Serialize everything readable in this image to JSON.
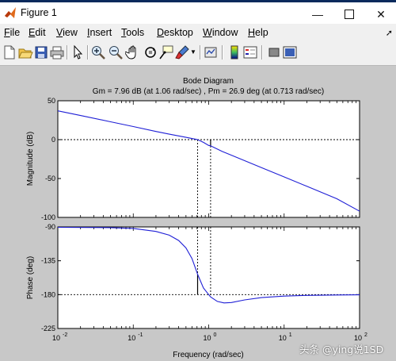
{
  "window": {
    "title": "Figure 1"
  },
  "menus": [
    {
      "key": "F",
      "rest": "ile"
    },
    {
      "key": "E",
      "rest": "dit"
    },
    {
      "key": "V",
      "rest": "iew"
    },
    {
      "key": "I",
      "rest": "nsert"
    },
    {
      "key": "T",
      "rest": "ools"
    },
    {
      "key": "D",
      "rest": "esktop"
    },
    {
      "key": "W",
      "rest": "indow"
    },
    {
      "key": "H",
      "rest": "elp"
    }
  ],
  "toolbar_icons": [
    "new-figure-icon",
    "open-file-icon",
    "save-icon",
    "print-icon",
    "edit-plot-arrow-icon",
    "zoom-in-icon",
    "zoom-out-icon",
    "pan-hand-icon",
    "rotate-3d-icon",
    "data-cursor-icon",
    "brush-icon",
    "link-plot-icon",
    "colorbar-icon",
    "legend-icon",
    "hide-plot-tools-icon",
    "show-plot-tools-icon"
  ],
  "watermark": "头条 @ying说1SD",
  "chart_data": {
    "type": "line",
    "title": "Bode Diagram",
    "subtitle": "Gm = 7.96 dB (at 1.06 rad/sec) ,  Pm = 26.9 deg (at 0.713 rad/sec)",
    "xlabel": "Frequency  (rad/sec)",
    "xscale": "log",
    "xlim": [
      0.01,
      100
    ],
    "x_ticks": [
      {
        "base": "10",
        "exp": "-2",
        "value": 0.01
      },
      {
        "base": "10",
        "exp": "-1",
        "value": 0.1
      },
      {
        "base": "10",
        "exp": "0",
        "value": 1
      },
      {
        "base": "10",
        "exp": "1",
        "value": 10
      },
      {
        "base": "10",
        "exp": "2",
        "value": 100
      }
    ],
    "grid": false,
    "line_color": "#1f1fd6",
    "gain_crossover": 0.713,
    "phase_crossover": 1.06,
    "magnitude": {
      "ylabel": "Magnitude (dB)",
      "ylim": [
        -100,
        50
      ],
      "y_ticks": [
        "50",
        "0",
        "-50",
        "-100"
      ],
      "y_tick_values": [
        50,
        0,
        -50,
        -100
      ],
      "x": [
        0.01,
        0.02,
        0.05,
        0.1,
        0.2,
        0.3,
        0.5,
        0.7,
        0.713,
        0.85,
        1.0,
        1.06,
        1.5,
        2,
        3,
        5,
        10,
        20,
        50,
        100
      ],
      "y": [
        37,
        31,
        23,
        16.8,
        10.5,
        7,
        3,
        0.2,
        0,
        -3.5,
        -7.5,
        -7.96,
        -15,
        -20,
        -27,
        -36,
        -48,
        -60,
        -76,
        -92
      ]
    },
    "phase": {
      "ylabel": "Phase (deg)",
      "ylim": [
        -225,
        -90
      ],
      "y_ticks": [
        "-90",
        "-135",
        "-180",
        "-225"
      ],
      "y_tick_values": [
        -90,
        -135,
        -180,
        -225
      ],
      "x": [
        0.01,
        0.05,
        0.1,
        0.2,
        0.3,
        0.4,
        0.5,
        0.6,
        0.713,
        0.85,
        1.0,
        1.06,
        1.3,
        1.6,
        2,
        3,
        5,
        10,
        20,
        50,
        100
      ],
      "y": [
        -90.5,
        -91,
        -92,
        -96,
        -101,
        -108,
        -118,
        -132,
        -153,
        -171,
        -180,
        -183,
        -189,
        -191,
        -190.5,
        -187,
        -184,
        -182,
        -181,
        -180.5,
        -180.3
      ]
    }
  }
}
